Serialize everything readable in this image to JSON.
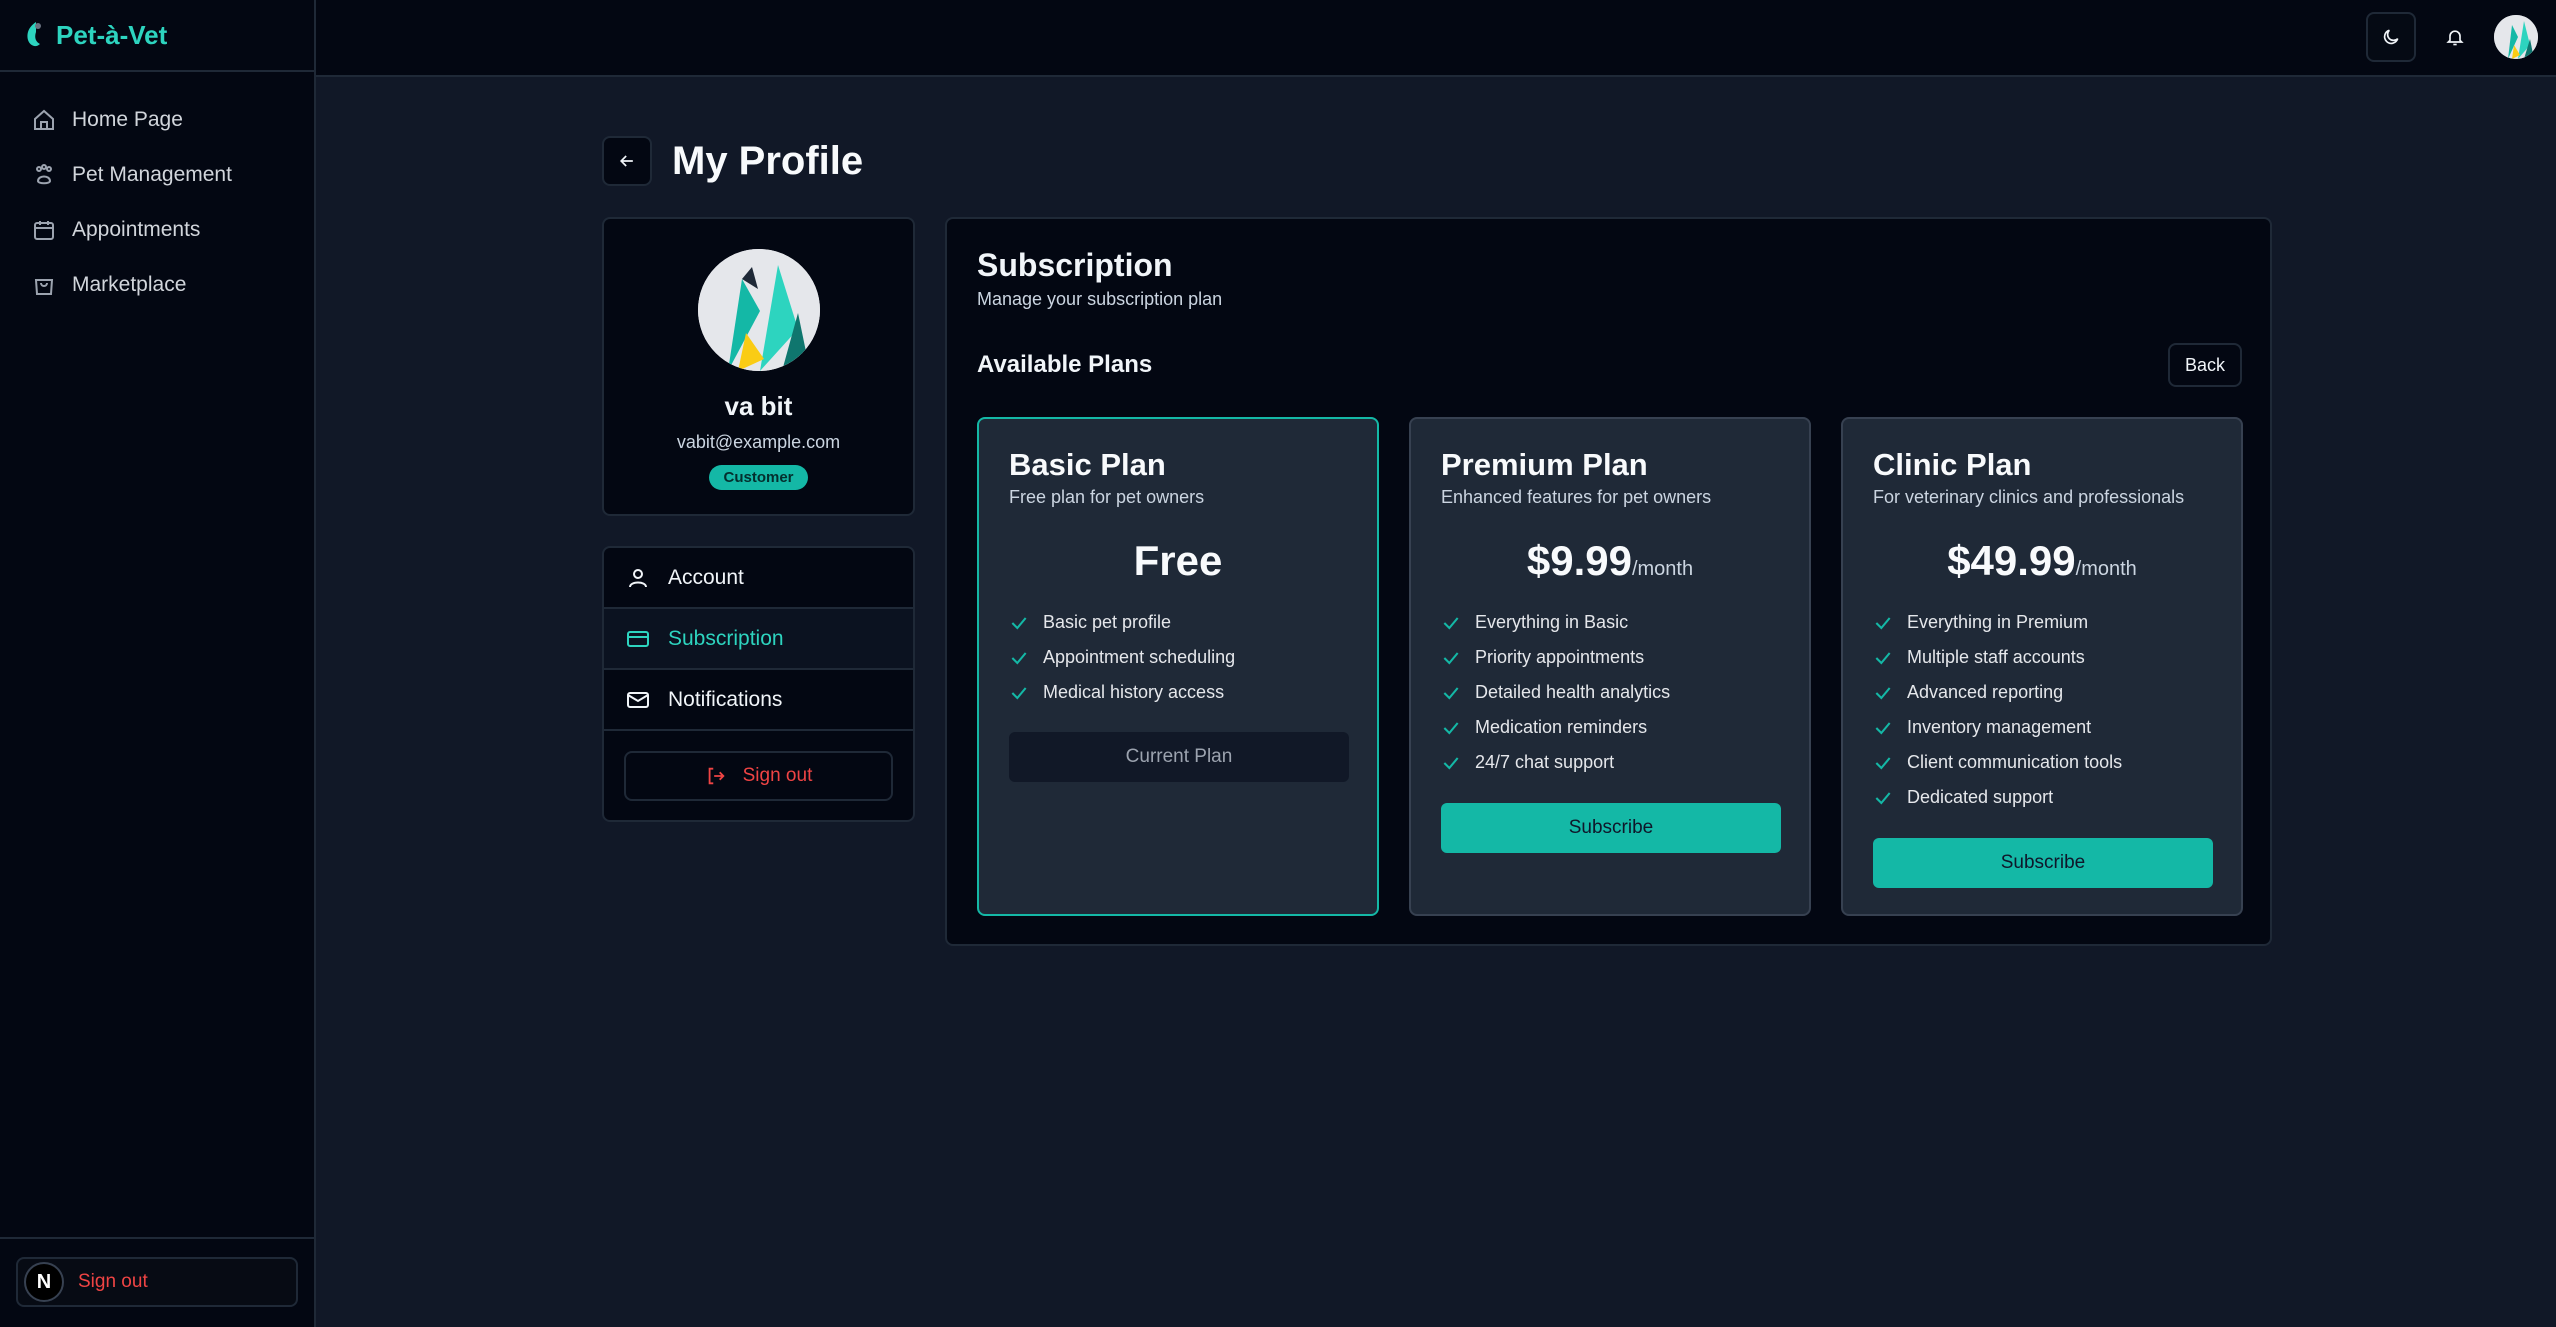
{
  "brand": {
    "name": "Pet-à-Vet"
  },
  "sidebar": {
    "items": [
      {
        "label": "Home Page",
        "icon": "home-icon"
      },
      {
        "label": "Pet Management",
        "icon": "paw-icon"
      },
      {
        "label": "Appointments",
        "icon": "calendar-icon"
      },
      {
        "label": "Marketplace",
        "icon": "shopping-bag-icon"
      }
    ],
    "footer": {
      "avatar_letter": "N",
      "signout_label": "Sign out"
    }
  },
  "page": {
    "title": "My Profile"
  },
  "profile": {
    "name": "va bit",
    "email": "vabit@example.com",
    "role": "Customer"
  },
  "profile_menu": {
    "items": [
      {
        "label": "Account",
        "icon": "user-icon"
      },
      {
        "label": "Subscription",
        "icon": "credit-card-icon",
        "active": true
      },
      {
        "label": "Notifications",
        "icon": "mail-icon"
      }
    ],
    "signout_label": "Sign out"
  },
  "subscription": {
    "title": "Subscription",
    "description": "Manage your subscription plan",
    "available_title": "Available Plans",
    "back_label": "Back",
    "plans": [
      {
        "title": "Basic Plan",
        "description": "Free plan for pet owners",
        "price": "Free",
        "period": "",
        "features": [
          "Basic pet profile",
          "Appointment scheduling",
          "Medical history access"
        ],
        "button": "Current Plan"
      },
      {
        "title": "Premium Plan",
        "description": "Enhanced features for pet owners",
        "price": "$9.99",
        "period": "/month",
        "features": [
          "Everything in Basic",
          "Priority appointments",
          "Detailed health analytics",
          "Medication reminders",
          "24/7 chat support"
        ],
        "button": "Subscribe"
      },
      {
        "title": "Clinic Plan",
        "description": "For veterinary clinics and professionals",
        "price": "$49.99",
        "period": "/month",
        "features": [
          "Everything in Premium",
          "Multiple staff accounts",
          "Advanced reporting",
          "Inventory management",
          "Client communication tools",
          "Dedicated support"
        ],
        "button": "Subscribe"
      }
    ]
  },
  "colors": {
    "accent": "#14b8a6",
    "danger": "#ef4444",
    "background": "#111827",
    "panel": "#030712"
  }
}
